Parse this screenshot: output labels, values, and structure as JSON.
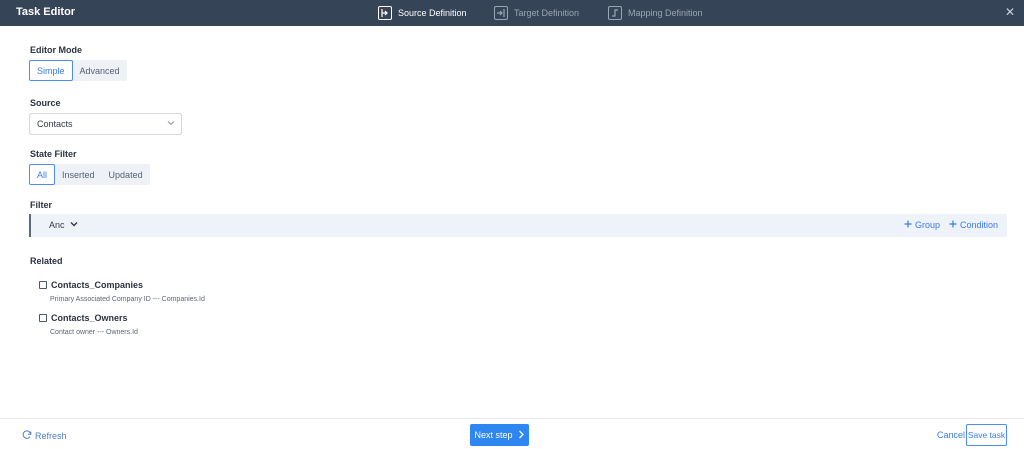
{
  "header": {
    "title": "Task Editor",
    "steps": [
      {
        "label": "Source Definition",
        "icon": "source-definition-icon",
        "active": true
      },
      {
        "label": "Target Definition",
        "icon": "target-definition-icon",
        "active": false
      },
      {
        "label": "Mapping Definition",
        "icon": "mapping-definition-icon",
        "active": false
      }
    ],
    "close_glyph": "✕"
  },
  "editor_mode": {
    "label": "Editor Mode",
    "options": [
      "Simple",
      "Advanced"
    ],
    "selected": "Simple"
  },
  "source": {
    "label": "Source",
    "value": "Contacts"
  },
  "state_filter": {
    "label": "State Filter",
    "options": [
      "All",
      "Inserted",
      "Updated"
    ],
    "selected": "All"
  },
  "filter": {
    "label": "Filter",
    "operator": "Anc",
    "group_label": "Group",
    "condition_label": "Condition"
  },
  "related": {
    "label": "Related",
    "items": [
      {
        "name": "Contacts_Companies",
        "description": "Primary Associated Company ID --- Companies.Id",
        "checked": false
      },
      {
        "name": "Contacts_Owners",
        "description": "Contact owner --- Owners.Id",
        "checked": false
      }
    ]
  },
  "footer": {
    "refresh_label": "Refresh",
    "next_label": "Next step",
    "cancel_label": "Cancel",
    "save_label": "Save task"
  },
  "colors": {
    "header_bg": "#364457",
    "accent": "#2e86f0",
    "link": "#3a7be8",
    "filter_bg": "#eef2f9"
  }
}
